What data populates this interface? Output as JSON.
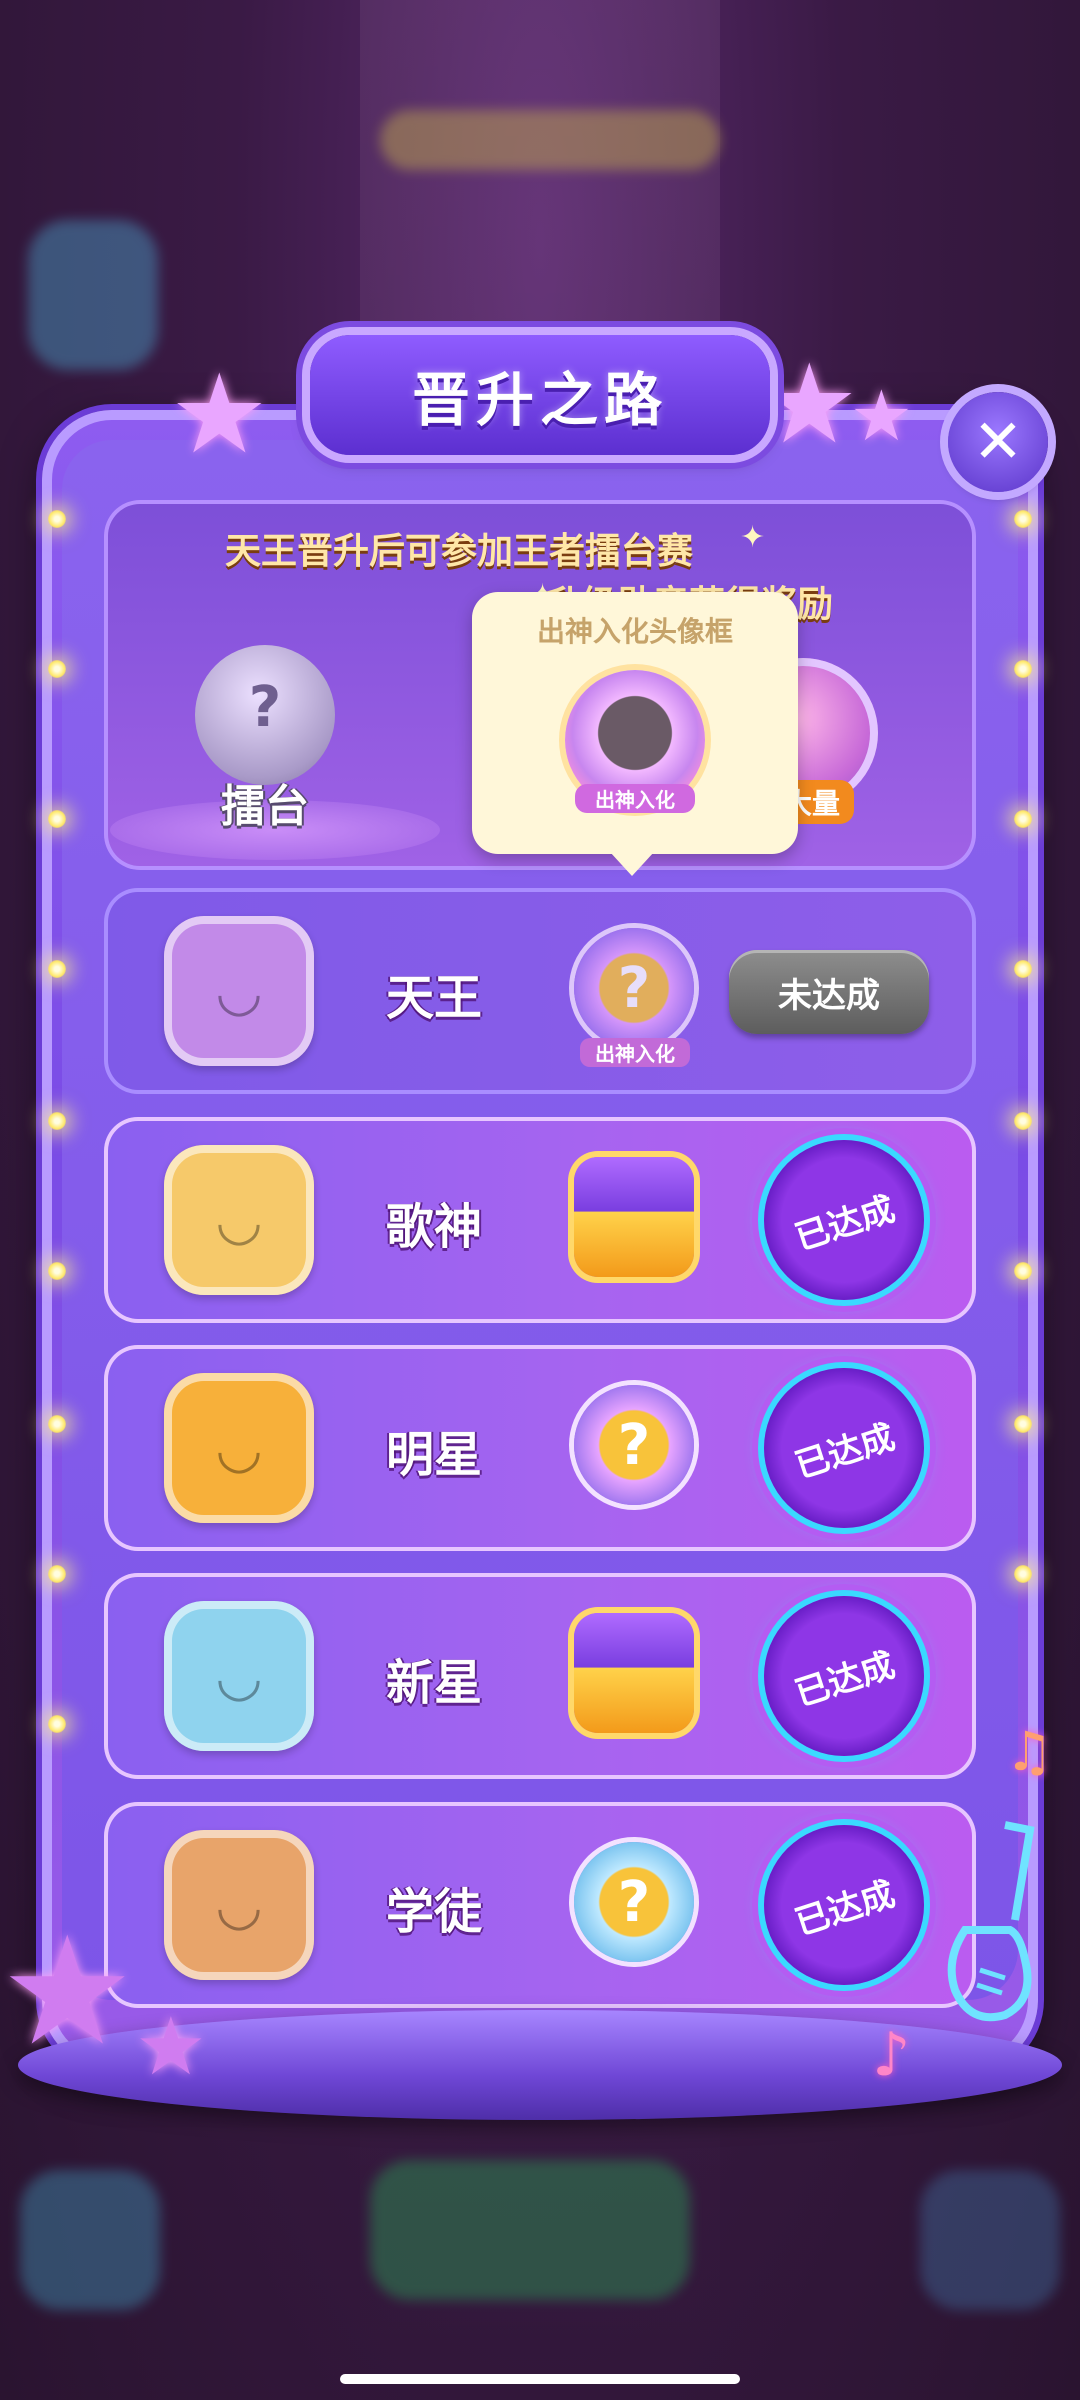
{
  "title": "晋升之路",
  "close_icon": "close-icon",
  "info": {
    "line1": "天王晋升后可参加王者擂台赛",
    "line2": "升级勋章获得奖励",
    "arena_label": "擂台",
    "arena_mark": "?",
    "gem_label": "超大量"
  },
  "tooltip": {
    "title": "出神入化头像框",
    "frame_label": "出神入化"
  },
  "ranks": [
    {
      "name": "天王",
      "reward_type": "frame",
      "reward_mark": "?",
      "reward_label": "出神入化",
      "status": "未达成",
      "achieved": false,
      "color": "#c28ae8"
    },
    {
      "name": "歌神",
      "reward_type": "chest",
      "status": "已达成",
      "achieved": true,
      "color": "#f6c96a"
    },
    {
      "name": "明星",
      "reward_type": "frame",
      "reward_mark": "?",
      "status": "已达成",
      "achieved": true,
      "color": "#f7b03a"
    },
    {
      "name": "新星",
      "reward_type": "chest",
      "status": "已达成",
      "achieved": true,
      "color": "#8fd3ee"
    },
    {
      "name": "学徒",
      "reward_type": "frame",
      "reward_mark": "?",
      "status": "已达成",
      "achieved": true,
      "color": "#e8a46a"
    }
  ]
}
